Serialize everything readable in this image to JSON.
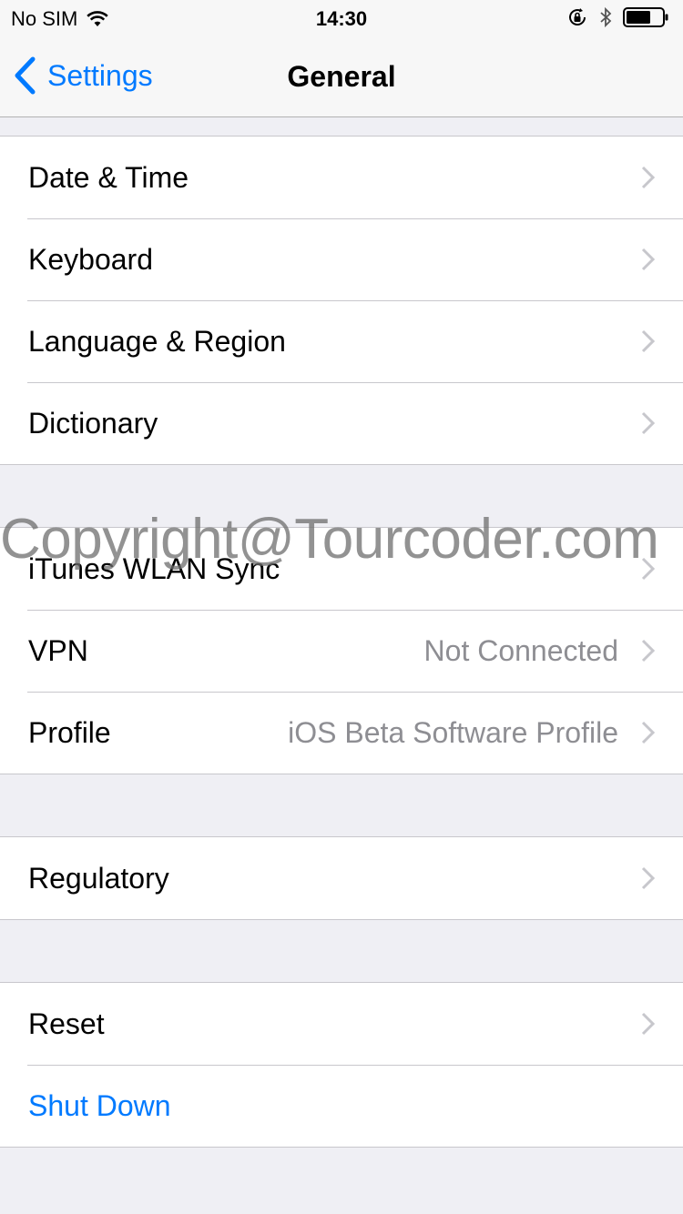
{
  "status_bar": {
    "carrier": "No SIM",
    "time": "14:30",
    "icons": [
      "wifi-icon",
      "orientation-lock-icon",
      "bluetooth-icon",
      "battery-icon"
    ]
  },
  "nav": {
    "back_label": "Settings",
    "title": "General"
  },
  "groups": [
    {
      "rows": [
        {
          "label": "Date & Time"
        },
        {
          "label": "Keyboard"
        },
        {
          "label": "Language & Region"
        },
        {
          "label": "Dictionary"
        }
      ]
    },
    {
      "rows": [
        {
          "label": "iTunes WLAN Sync"
        },
        {
          "label": "VPN",
          "value": "Not Connected"
        },
        {
          "label": "Profile",
          "value": "iOS Beta Software Profile"
        }
      ]
    },
    {
      "rows": [
        {
          "label": "Regulatory"
        }
      ]
    },
    {
      "rows": [
        {
          "label": "Reset"
        },
        {
          "label": "Shut Down"
        }
      ]
    }
  ],
  "watermark": "Copyright@Tourcoder.com",
  "colors": {
    "accent": "#007aff",
    "background": "#efeff4",
    "secondary_text": "#8e8e93"
  }
}
